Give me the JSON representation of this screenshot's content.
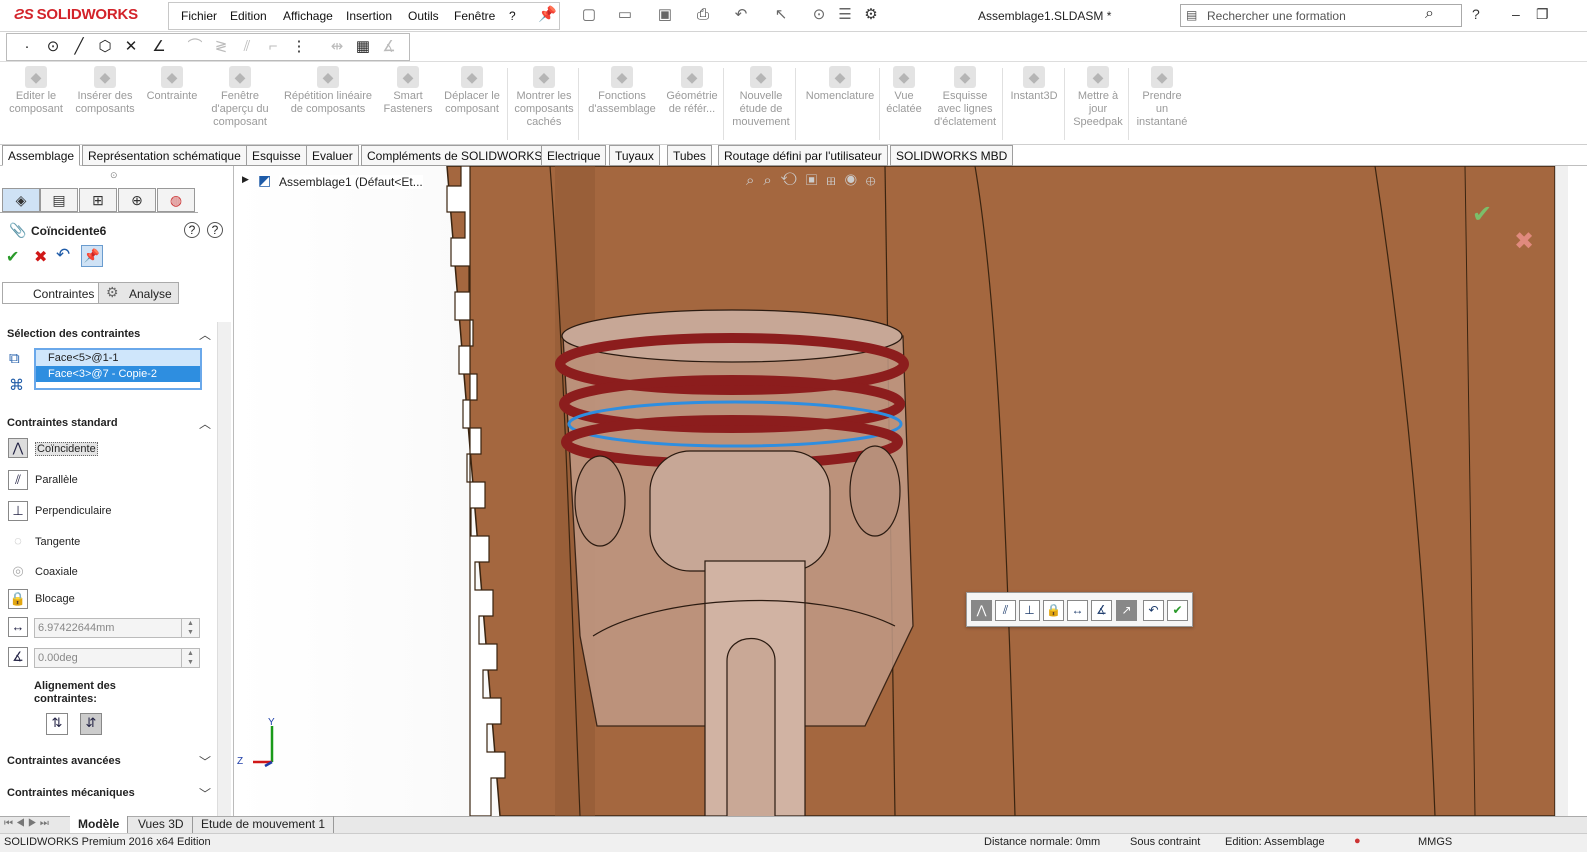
{
  "app": {
    "name": "SOLIDWORKS",
    "document_title": "Assemblage1.SLDASM *"
  },
  "menu": [
    "Fichier",
    "Edition",
    "Affichage",
    "Insertion",
    "Outils",
    "Fenêtre",
    "?"
  ],
  "search": {
    "placeholder": "Rechercher une formation"
  },
  "command_manager": [
    {
      "label": "Editer le composant",
      "icon": "edit-component-icon"
    },
    {
      "label": "Insérer des composants",
      "icon": "insert-components-icon"
    },
    {
      "label": "Contrainte",
      "icon": "mate-icon"
    },
    {
      "label": "Fenêtre d'aperçu du composant",
      "icon": "preview-window-icon"
    },
    {
      "label": "Répétition linéaire de composants",
      "icon": "linear-pattern-icon"
    },
    {
      "label": "Smart Fasteners",
      "icon": "fastener-icon"
    },
    {
      "label": "Déplacer le composant",
      "icon": "move-component-icon"
    },
    {
      "label": "Montrer les composants cachés",
      "icon": "show-hidden-icon"
    },
    {
      "label": "Fonctions d'assemblage",
      "icon": "assembly-features-icon"
    },
    {
      "label": "Géométrie de référ...",
      "icon": "reference-geometry-icon"
    },
    {
      "label": "Nouvelle étude de mouvement",
      "icon": "motion-study-icon"
    },
    {
      "label": "Nomenclature",
      "icon": "bom-icon"
    },
    {
      "label": "Vue éclatée",
      "icon": "exploded-view-icon"
    },
    {
      "label": "Esquisse avec lignes d'éclatement",
      "icon": "explode-line-icon"
    },
    {
      "label": "Instant3D",
      "icon": "instant3d-icon"
    },
    {
      "label": "Mettre à jour Speedpak",
      "icon": "speedpak-icon"
    },
    {
      "label": "Prendre un instantané",
      "icon": "snapshot-icon"
    }
  ],
  "tabs": [
    "Assemblage",
    "Représentation schématique",
    "Esquisse",
    "Evaluer",
    "Compléments de SOLIDWORKS",
    "Electrique",
    "Tuyaux",
    "Tubes",
    "Routage défini par l'utilisateur",
    "SOLIDWORKS MBD"
  ],
  "property_manager": {
    "feature_name": "Coïncidente6",
    "subtabs": [
      "Contraintes",
      "Analyse"
    ],
    "selection_header": "Sélection des contraintes",
    "selections": [
      "Face<5>@1-1",
      "Face<3>@7 - Copie-2"
    ],
    "standard_header": "Contraintes standard",
    "standard_mates": [
      "Coïncidente",
      "Parallèle",
      "Perpendiculaire",
      "Tangente",
      "Coaxiale",
      "Blocage"
    ],
    "distance_value": "6.97422644mm",
    "angle_value": "0.00deg",
    "alignment_label": "Alignement des contraintes:",
    "advanced_header": "Contraintes avancées",
    "mechanical_header": "Contraintes mécaniques"
  },
  "tree": {
    "root": "Assemblage1  (Défaut<Et..."
  },
  "bottom_tabs": [
    "Modèle",
    "Vues 3D",
    "Etude de mouvement 1"
  ],
  "status": {
    "left": "SOLIDWORKS Premium 2016 x64 Edition",
    "distance": "Distance normale: 0mm",
    "constraint": "Sous contraint",
    "mode": "Edition: Assemblage",
    "units": "MMGS"
  },
  "colors": {
    "brand": "#d3232a",
    "ring": "#8c1d1d",
    "cylinder": "#a4673f",
    "selection": "#2e8ee0"
  }
}
